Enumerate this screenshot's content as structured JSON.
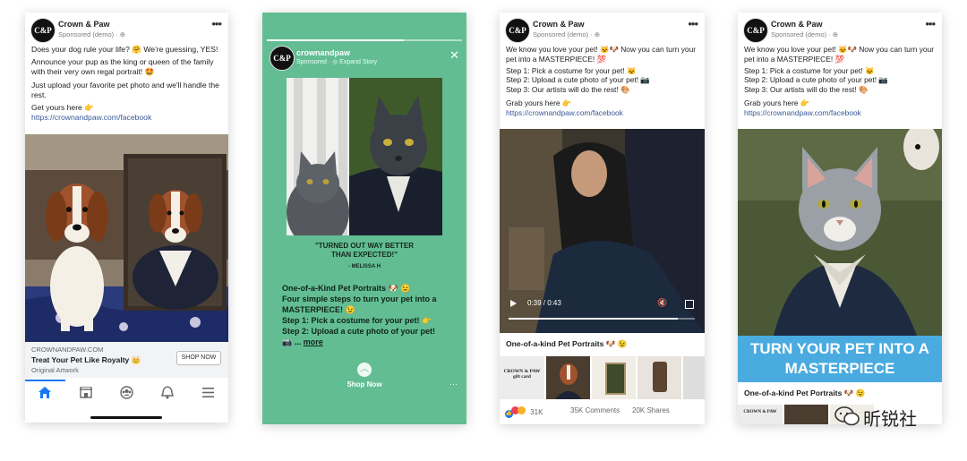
{
  "brand": {
    "name": "Crown & Paw",
    "logo_text": "C&P",
    "sponsored": "Sponsored (demo) · ⊕"
  },
  "ad1": {
    "text": [
      "Does your dog rule your life? 🤗 We're guessing, YES!",
      "Announce your pup as the king or queen of the family with their very own regal portrait! 🤩",
      "Just upload your favorite pet photo and we'll handle the rest.",
      "Get yours here 👉"
    ],
    "link": "https://crownandpaw.com/facebook",
    "domain": "CROWNANDPAW.COM",
    "headline": "Treat Your Pet Like Royalty 👑",
    "desc": "Original Artwork",
    "cta": "SHOP NOW",
    "nav_icons": [
      "home-icon",
      "marketplace-icon",
      "groups-icon",
      "bell-icon",
      "menu-icon"
    ]
  },
  "story": {
    "handle": "crownandpaw",
    "sponsored": "Sponsored · ◎ Expand Story",
    "close": "✕",
    "quote": "\"TURNED OUT WAY BETTER THAN EXPECTED!\"",
    "author": "- MELISSA H",
    "body": [
      "One-of-a-Kind Pet Portraits 🐶 😉",
      "Four simple steps to turn your pet into a MASTERPIECE! 😉",
      "Step 1: Pick a costume for your pet! 👉",
      "Step 2: Upload a cute photo of your pet!"
    ],
    "more_prefix": "📷 ... ",
    "more": "more",
    "shop": "Shop Now",
    "more_dots": "···"
  },
  "ad3": {
    "text": [
      "We know you love your pet! 🐱🐶 Now you can turn your pet into a MASTERPIECE! 💯",
      "Step 1: Pick a costume for your pet! 🐱",
      "Step 2: Upload a cute photo of your pet! 📷",
      "Step 3: Our artists will do the rest! 🎨",
      "Grab yours here 👉"
    ],
    "link": "https://crownandpaw.com/facebook",
    "time": "0:39 / 0:43",
    "progress": 0.91,
    "headline": "One-of-a-kind Pet Portraits 🐶 😉",
    "giftcard": "CROWN & PAW gift card",
    "reactions_count": "31K",
    "comments": "35K Comments",
    "shares": "20K Shares"
  },
  "ad4": {
    "text": [
      "We know you love your pet! 🐱🐶 Now you can turn your pet into a MASTERPIECE! 💯",
      "Step 1: Pick a costume for your pet! 🐱",
      "Step 2: Upload a cute photo of your pet! 📷",
      "Step 3: Our artists will do the rest! 🎨",
      "Grab yours here 👉"
    ],
    "link": "https://crownandpaw.com/facebook",
    "banner": "TURN YOUR PET INTO A MASTERPIECE",
    "headline": "One-of-a-kind Pet Portraits 🐶 😉",
    "giftcard": "CROWN & PAW"
  },
  "watermark": "昕锐社"
}
